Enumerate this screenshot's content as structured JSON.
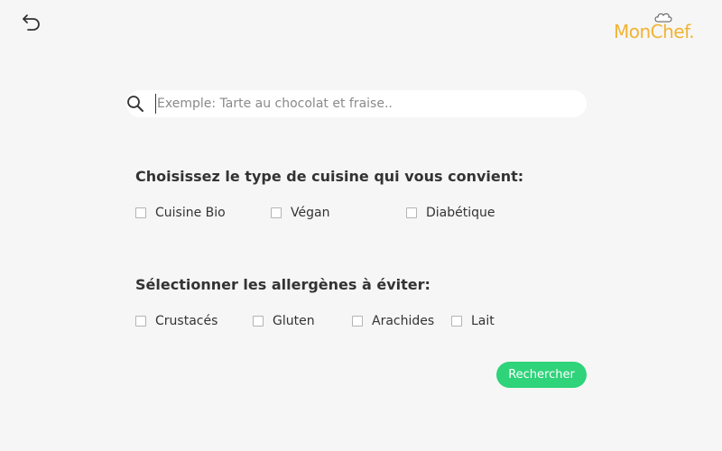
{
  "header": {
    "back_icon": "undo-arrow-icon",
    "logo_text": "MonChef.",
    "logo_icon": "chef-hat-icon",
    "logo_color": "#f0b432"
  },
  "search": {
    "icon": "search-icon",
    "value": "",
    "placeholder": "Exemple: Tarte au chocolat et fraise.."
  },
  "cuisine": {
    "title": "Choisissez le type de cuisine qui vous convient:",
    "options": [
      {
        "label": "Cuisine Bio",
        "checked": false
      },
      {
        "label": "Végan",
        "checked": false
      },
      {
        "label": "Diabétique",
        "checked": false
      }
    ]
  },
  "allergens": {
    "title": "Sélectionner les allergènes à éviter:",
    "options": [
      {
        "label": "Crustacés",
        "checked": false
      },
      {
        "label": "Gluten",
        "checked": false
      },
      {
        "label": "Arachides",
        "checked": false
      },
      {
        "label": "Lait",
        "checked": false
      }
    ]
  },
  "actions": {
    "search_label": "Rechercher",
    "search_color": "#2ed37a"
  }
}
